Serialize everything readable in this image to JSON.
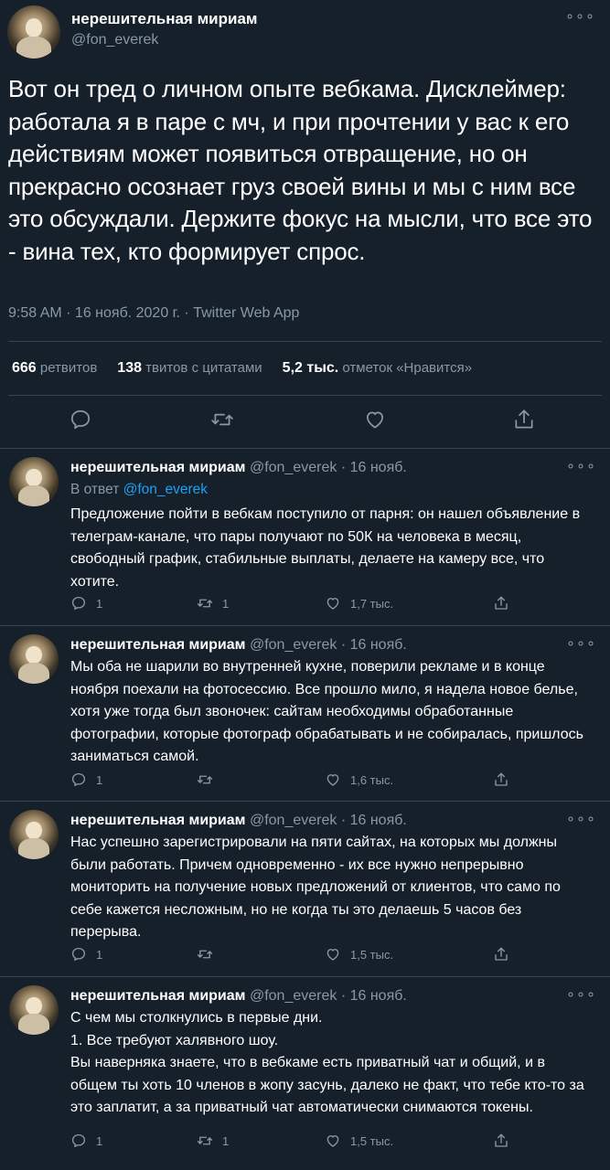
{
  "main_tweet": {
    "display_name": "нерешительная мириам",
    "handle": "@fon_everek",
    "text": "Вот он тред о личном опыте вебкама. Дисклеймер: работала я в паре с мч, и при прочтении у вас к его действиям может появиться отвращение, но он прекрасно осознает груз своей вины и мы с ним все это обсуждали. Держите фокус на мысли, что все это - вина тех, кто формирует спрос.",
    "meta": "9:58 AM · 16 нояб. 2020 г. · Twitter Web App",
    "stats": {
      "retweets_count": "666",
      "retweets_label": "ретвитов",
      "quotes_count": "138",
      "quotes_label": "твитов с цитатами",
      "likes_count": "5,2 тыс.",
      "likes_label": "отметок «Нравится»"
    },
    "more_icon": "more-dots-icon"
  },
  "replies": [
    {
      "display_name": "нерешительная мириам",
      "handle": "@fon_everek",
      "time": "16 нояб.",
      "in_reply_label": "В ответ",
      "in_reply_handle": "@fon_everek",
      "text": "Предложение пойти в вебкам поступило от парня: он нашел объявление в телеграм-канале, что пары получают по 50К на человека в месяц, свободный график, стабильные выплаты, делаете на камеру все, что хотите.",
      "reply_count": "1",
      "retweet_count": "1",
      "like_count": "1,7 тыс."
    },
    {
      "display_name": "нерешительная мириам",
      "handle": "@fon_everek",
      "time": "16 нояб.",
      "text": "Мы оба не шарили во внутренней кухне, поверили рекламе и в конце ноября поехали на фотосессию. Все прошло мило, я надела новое белье, хотя уже тогда был звоночек: сайтам необходимы обработанные фотографии, которые фотограф обрабатывать и не собиралась, пришлось заниматься самой.",
      "reply_count": "1",
      "retweet_count": "",
      "like_count": "1,6 тыс."
    },
    {
      "display_name": "нерешительная мириам",
      "handle": "@fon_everek",
      "time": "16 нояб.",
      "text": "Нас успешно зарегистрировали на пяти сайтах, на которых мы должны были работать. Причем одновременно - их все нужно непрерывно мониторить на получение новых предложений от клиентов, что само по себе кажется несложным, но не когда ты это делаешь 5 часов без перерыва.",
      "reply_count": "1",
      "retweet_count": "",
      "like_count": "1,5 тыс."
    },
    {
      "display_name": "нерешительная мириам",
      "handle": "@fon_everek",
      "time": "16 нояб.",
      "text_lines": [
        "С чем мы столкнулись в первые дни.",
        "1. Все требуют халявного шоу.",
        "Вы наверняка знаете, что в вебкаме есть приватный чат и общий, и в общем ты хоть 10 членов в жопу засунь, далеко не факт, что тебе кто-то за это заплатит, а за приватный чат автоматически снимаются токены."
      ],
      "reply_count": "1",
      "retweet_count": "1",
      "like_count": "1,5 тыс."
    }
  ],
  "colors": {
    "background": "#15202b",
    "text": "#ffffff",
    "muted": "#8899a6",
    "link": "#1da1f2",
    "divider": "#38444d"
  }
}
